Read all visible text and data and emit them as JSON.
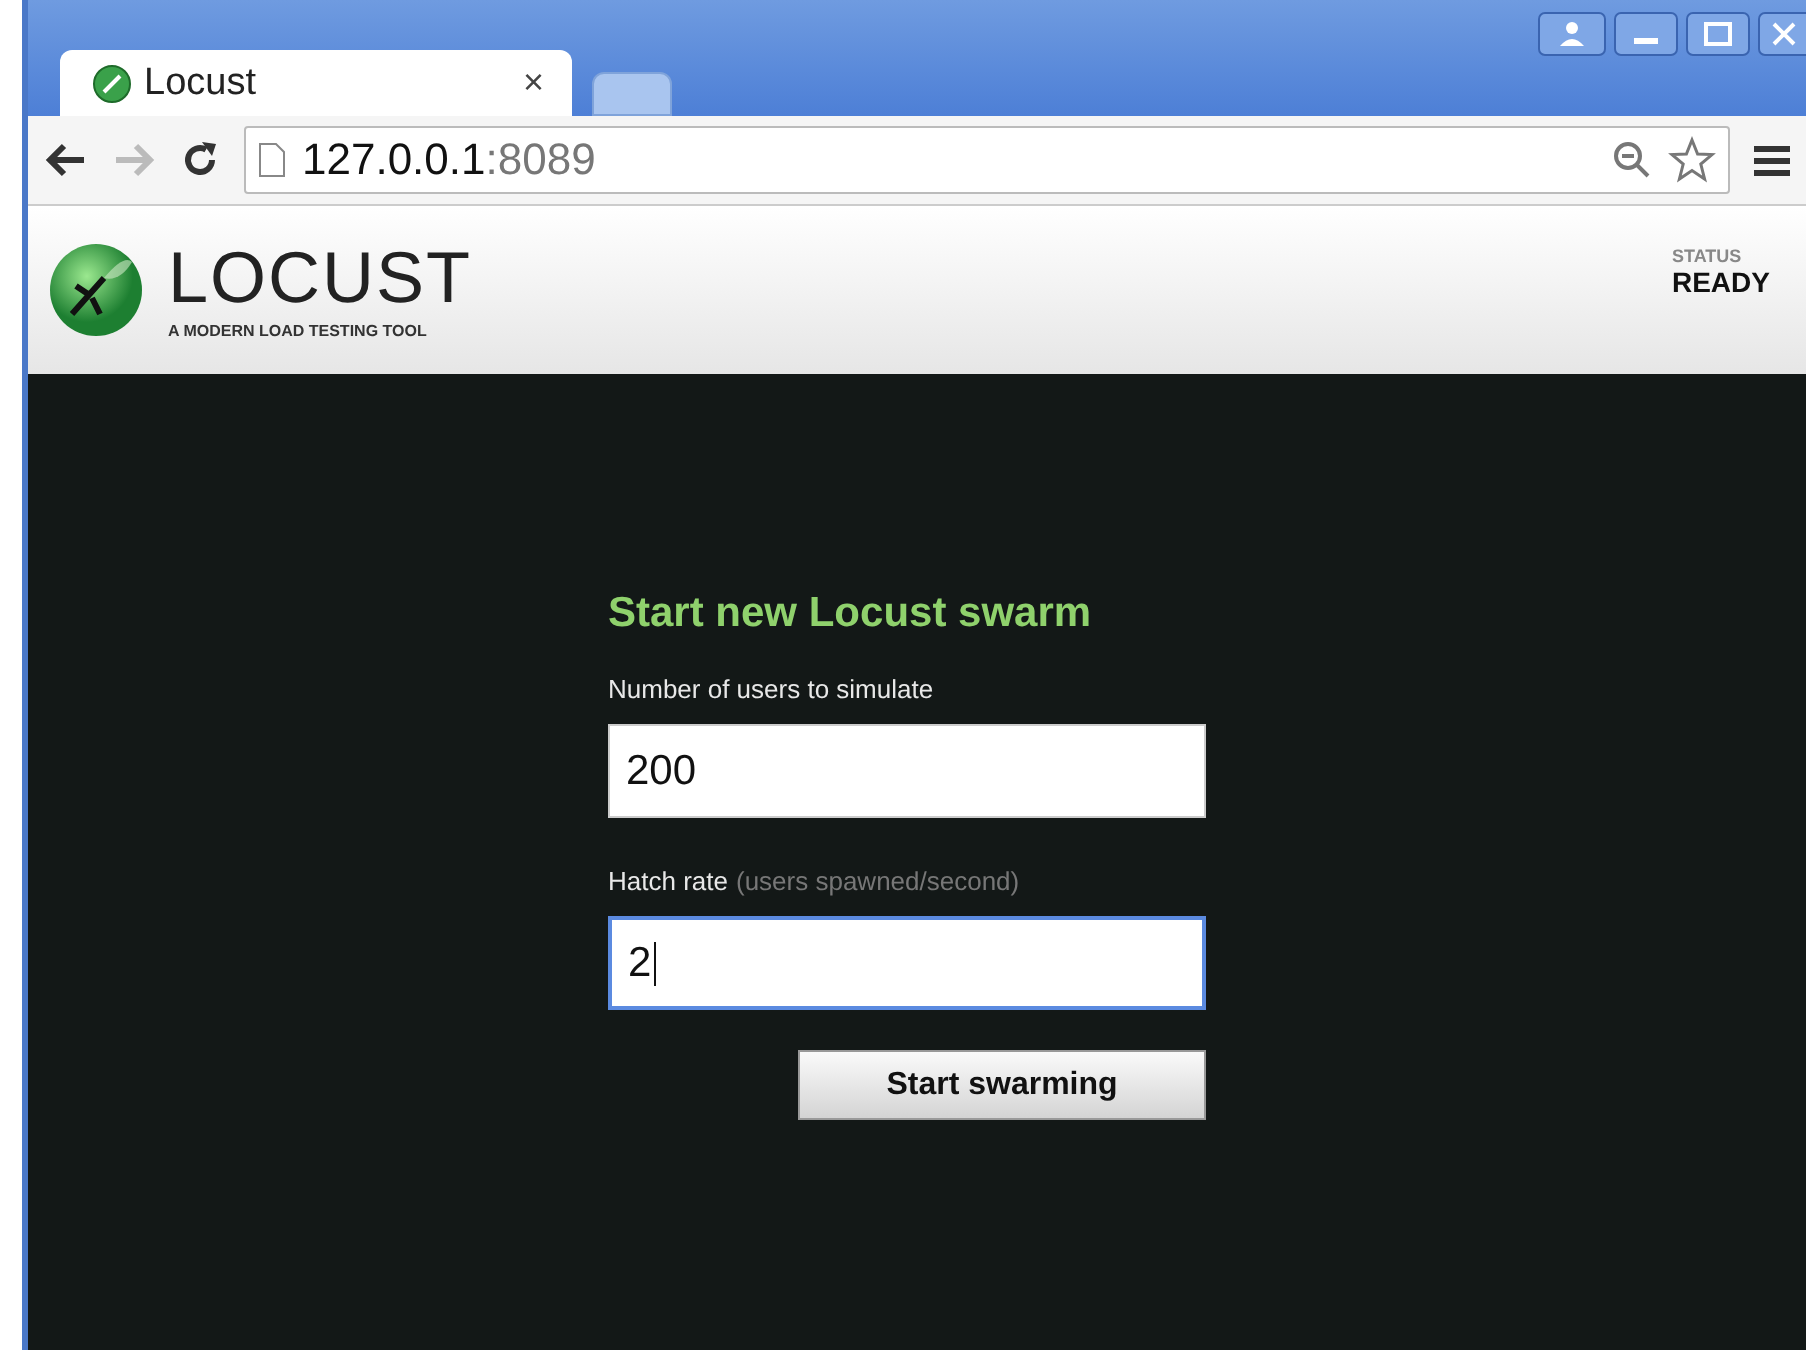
{
  "browser": {
    "tabs": [
      {
        "title": "Locust",
        "selected": true,
        "close": "×"
      },
      {
        "selected": false
      }
    ],
    "address": {
      "host": "127.0.0.1",
      "port": ":8089"
    }
  },
  "header": {
    "logo_title": "LOCUST",
    "logo_subtitle": "A MODERN LOAD TESTING TOOL",
    "status_label": "STATUS",
    "status_value": "READY"
  },
  "form": {
    "title": "Start new Locust swarm",
    "fields": [
      {
        "label": "Number of users to simulate",
        "value": "200",
        "focused": false
      },
      {
        "label": "Hatch rate",
        "hint": "(users spawned/second)",
        "value": "2",
        "focused": true
      }
    ],
    "button": "Start swarming"
  }
}
